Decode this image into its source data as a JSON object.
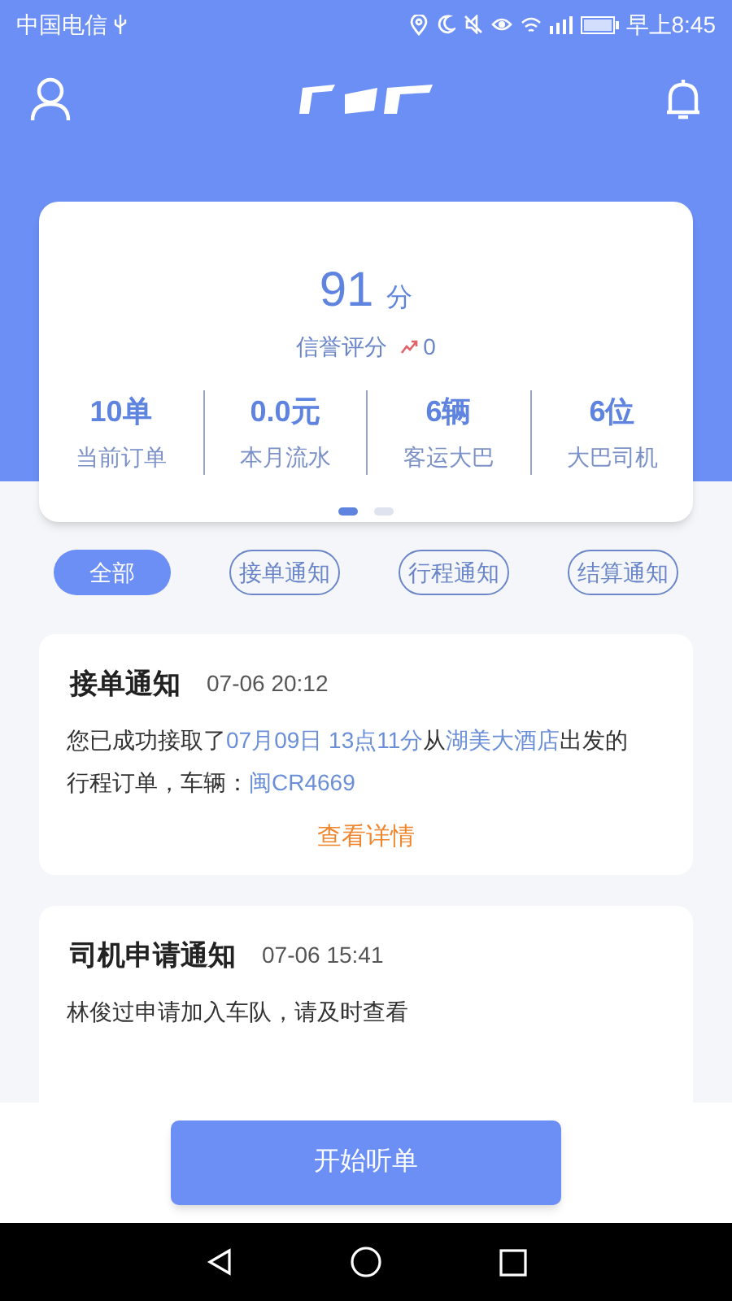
{
  "status_bar": {
    "carrier": "中国电信",
    "time": "早上8:45"
  },
  "score": {
    "value": "91",
    "unit": "分",
    "label": "信誉评分",
    "change": "0"
  },
  "stats": [
    {
      "value": "10单",
      "label": "当前订单"
    },
    {
      "value": "0.0元",
      "label": "本月流水"
    },
    {
      "value": "6辆",
      "label": "客运大巴"
    },
    {
      "value": "6位",
      "label": "大巴司机"
    }
  ],
  "pager": [
    {
      "selected": true
    },
    {
      "selected": false
    }
  ],
  "filters": [
    {
      "label": "全部",
      "selected": true
    },
    {
      "label": "接单通知",
      "selected": false
    },
    {
      "label": "行程通知",
      "selected": false
    },
    {
      "label": "结算通知",
      "selected": false
    }
  ],
  "notifications": [
    {
      "title": "接单通知",
      "time": "07-06 20:12",
      "message": [
        {
          "text": "您已成功接取了",
          "highlight": false
        },
        {
          "text": "07月09日 13点11分",
          "highlight": true
        },
        {
          "text": "从",
          "highlight": false
        },
        {
          "text": "湖美大酒店",
          "highlight": true
        },
        {
          "text": "出发的行程订单，车辆：",
          "highlight": false
        },
        {
          "text": "闽CR4669",
          "highlight": true
        }
      ],
      "action": "查看详情"
    },
    {
      "title": "司机申请通知",
      "time": "07-06 15:41",
      "message": [
        {
          "text": "林俊过申请加入车队，请及时查看",
          "highlight": false
        }
      ]
    }
  ],
  "primary_button": "开始听单"
}
